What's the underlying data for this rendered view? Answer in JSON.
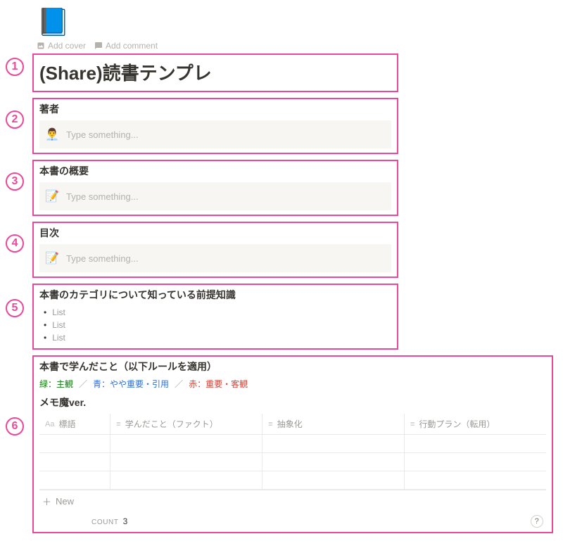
{
  "page_icon": "📘",
  "cover_actions": {
    "add_cover": "Add cover",
    "add_comment": "Add comment"
  },
  "title": "(Share)読書テンプレ",
  "sections": {
    "author": {
      "heading": "著者",
      "emoji": "👨‍💼",
      "placeholder": "Type something..."
    },
    "summary": {
      "heading": "本書の概要",
      "emoji": "📝",
      "placeholder": "Type something..."
    },
    "toc": {
      "heading": "目次",
      "emoji": "📝",
      "placeholder": "Type something..."
    },
    "prior": {
      "heading": "本書のカテゴリについて知っている前提知識",
      "items": [
        "List",
        "List",
        "List"
      ]
    },
    "learned": {
      "heading": "本書で学んだこと（以下ルールを適用）",
      "rules": {
        "green_label": "緑：主観",
        "blue_label": "青：やや重要・引用",
        "red_label": "赤：重要・客観"
      },
      "db_title": "メモ魔ver.",
      "columns": [
        "標語",
        "学んだこと（ファクト）",
        "抽象化",
        "行動プラン（転用）"
      ],
      "new_label": "New",
      "count_label": "COUNT",
      "count_value": "3"
    }
  },
  "help_label": "?"
}
